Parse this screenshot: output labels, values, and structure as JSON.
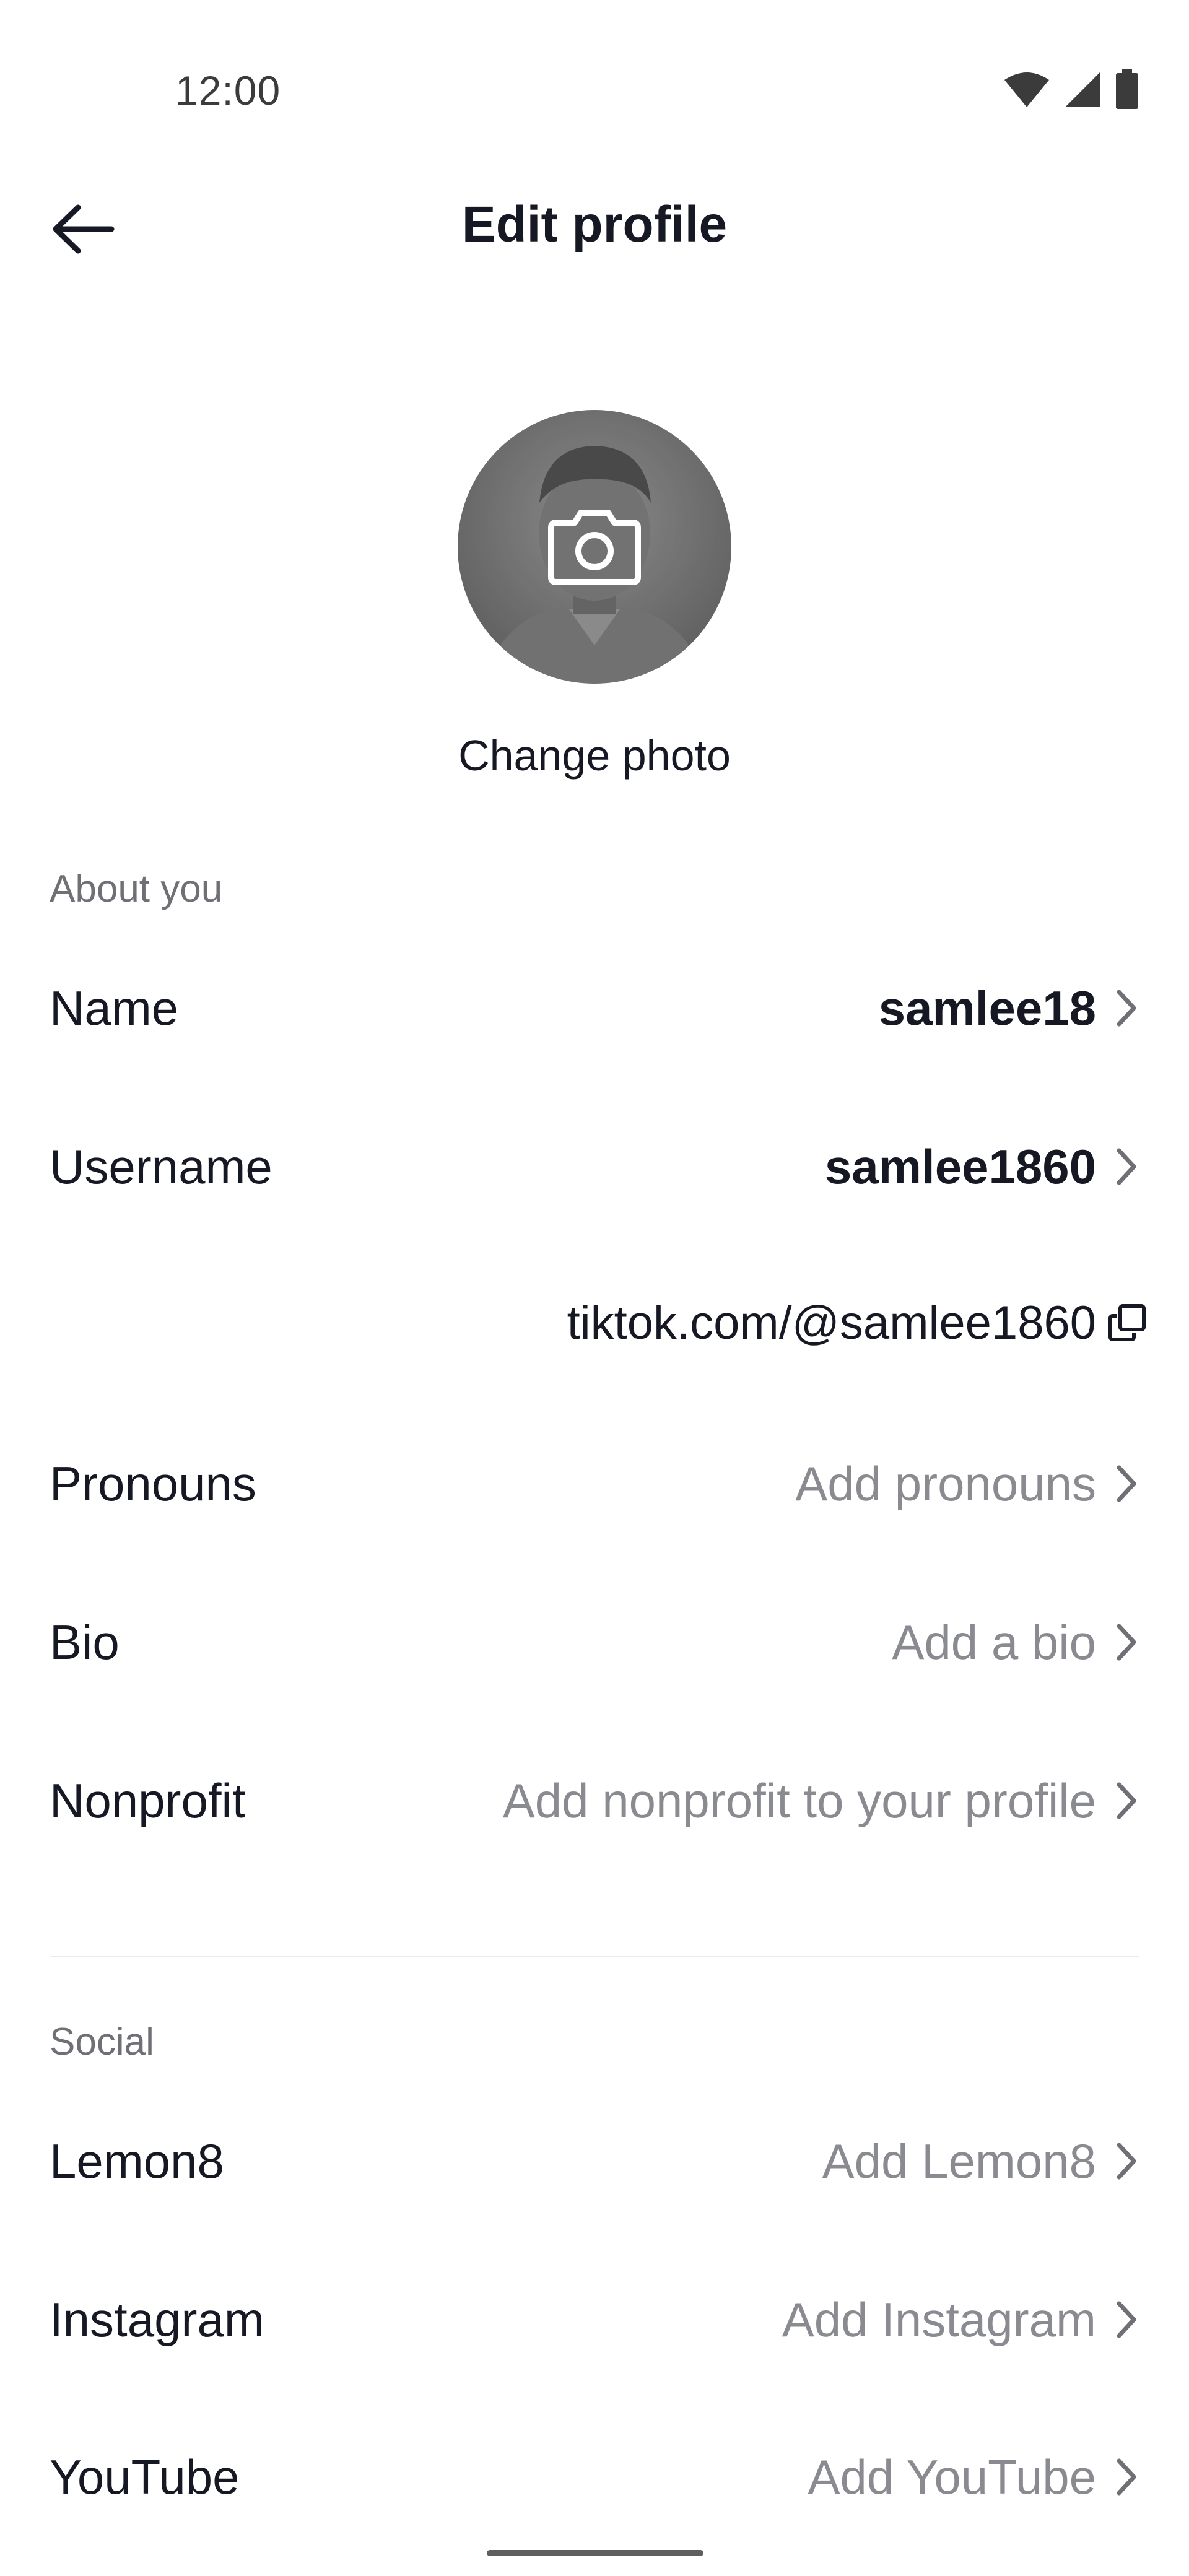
{
  "status_bar": {
    "time": "12:00",
    "icons": [
      "wifi-icon",
      "signal-icon",
      "battery-icon"
    ]
  },
  "header": {
    "title": "Edit profile",
    "back_icon": "arrow-left-icon"
  },
  "profile_photo": {
    "camera_icon": "camera-icon",
    "change_label": "Change photo"
  },
  "about": {
    "section_label": "About you",
    "name": {
      "label": "Name",
      "value": "samlee18"
    },
    "username": {
      "label": "Username",
      "value": "samlee1860"
    },
    "profile_link": {
      "value": "tiktok.com/@samlee1860",
      "icon": "copy-icon"
    },
    "pronouns": {
      "label": "Pronouns",
      "value": "Add pronouns"
    },
    "bio": {
      "label": "Bio",
      "value": "Add a bio"
    },
    "nonprofit": {
      "label": "Nonprofit",
      "value": "Add nonprofit to your profile"
    }
  },
  "social": {
    "section_label": "Social",
    "lemon8": {
      "label": "Lemon8",
      "value": "Add Lemon8"
    },
    "instagram": {
      "label": "Instagram",
      "value": "Add Instagram"
    },
    "youtube": {
      "label": "YouTube",
      "value": "Add YouTube"
    }
  },
  "colors": {
    "primary_text": "#161823",
    "secondary_text": "#8a8b91",
    "section_label": "#6f6f76",
    "divider": "#ececee"
  }
}
